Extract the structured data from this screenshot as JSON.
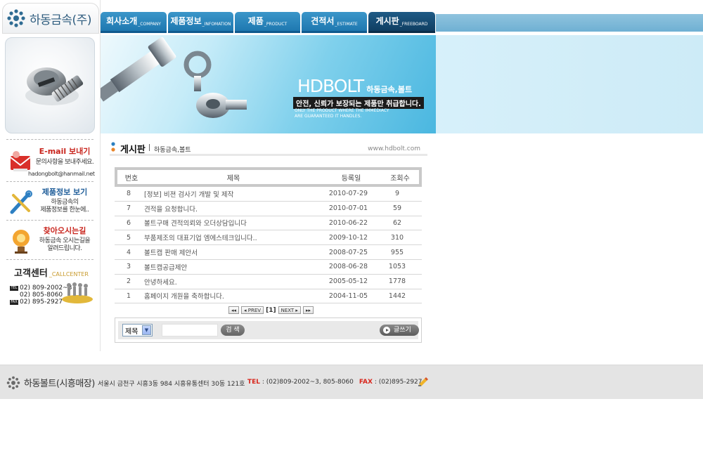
{
  "brand": {
    "logo_text": "하동금속(주)"
  },
  "nav": {
    "tabs": [
      {
        "ko": "회사소개",
        "en": "_COMPANY",
        "active": false
      },
      {
        "ko": "제품정보",
        "en": "_INFOMATION",
        "active": false
      },
      {
        "ko": "제품",
        "en": "_PRODUCT",
        "active": false
      },
      {
        "ko": "견적서",
        "en": "_ESTIMATE",
        "active": false
      },
      {
        "ko": "게시판",
        "en": "_FREEBOARD",
        "active": true
      }
    ]
  },
  "banner": {
    "brand_big": "HDBOLT",
    "brand_small": "하동금속,볼트",
    "slogan": "안전, 신뢰가 보장되는 제품만 취급합니다.",
    "english_line1": "ONLY THE PRODUCT WHERE THE IMMEDIACY",
    "english_line2": "ARE GUARANTEED IT HANDLES."
  },
  "sidebar": {
    "email": {
      "title": "E-mail 보내기",
      "desc": "문의사항을 보내주세요.",
      "address": "hadongbolt@hanmail.net",
      "icon": "mail-icon"
    },
    "product_info": {
      "title": "제품정보 보기",
      "desc_line1": "하동금속의",
      "desc_line2": "제품정보를 한눈에..",
      "icon": "tools-icon"
    },
    "directions": {
      "title": "찾아오시는길",
      "desc_line1": "하동금속 오시는길을",
      "desc_line2": "알려드립니다.",
      "icon": "lamp-icon"
    },
    "call_center": {
      "title": "고객센터",
      "title_en": "_CALLCENTER",
      "tel_tag": "TEL",
      "fax_tag": "FAX",
      "tel1": "02) 809-2002~3",
      "tel2": "02) 805-8060",
      "fax": "02) 895-2927"
    }
  },
  "board": {
    "title": "게시판",
    "subtitle": "하동금속,볼트",
    "site_url": "www.hdbolt.com",
    "columns": {
      "no": "번호",
      "title": "제목",
      "date": "등록일",
      "views": "조회수"
    },
    "rows": [
      {
        "no": "8",
        "title": "[정보] 비젼 검사기 개발 및 제작",
        "date": "2010-07-29",
        "views": "9"
      },
      {
        "no": "7",
        "title": "견적을 요청합니다.",
        "date": "2010-07-01",
        "views": "59"
      },
      {
        "no": "6",
        "title": "볼트구매 견적의뢰와 오더상담입니다",
        "date": "2010-06-22",
        "views": "62"
      },
      {
        "no": "5",
        "title": "부품제조의 대표기업 엠에스테크입니다..",
        "date": "2009-10-12",
        "views": "310"
      },
      {
        "no": "4",
        "title": "볼트캡 판매 제안서",
        "date": "2008-07-25",
        "views": "955"
      },
      {
        "no": "3",
        "title": "볼트캡공급제안",
        "date": "2008-06-28",
        "views": "1053"
      },
      {
        "no": "2",
        "title": "안녕하세요.",
        "date": "2005-05-12",
        "views": "1778"
      },
      {
        "no": "1",
        "title": "홈페이지 개원을 축하합니다.",
        "date": "2004-11-05",
        "views": "1442"
      }
    ],
    "pager": {
      "first": "◂◂",
      "prev": "◂ PREV",
      "current": "[1]",
      "next": "NEXT ▸",
      "last": "▸▸"
    },
    "search": {
      "field_selected": "제목",
      "input_value": "",
      "button_label": "검 색",
      "write_label": "글쓰기"
    }
  },
  "footer": {
    "brand": "하동볼트(시흥매장)",
    "address": "서울시 금천구 시흥3동 984 시흥유통센터 30동 121호",
    "tel_label": "TEL",
    "tel_value": " : (02)809-2002~3, 805-8060",
    "fax_label": "FAX",
    "fax_value": " : (02)895-2927"
  },
  "colors": {
    "nav_tab": "#2a86bf",
    "nav_tab_active": "#174a72",
    "footer_bg": "#e4e4e4",
    "accent_red": "#d8261c"
  }
}
